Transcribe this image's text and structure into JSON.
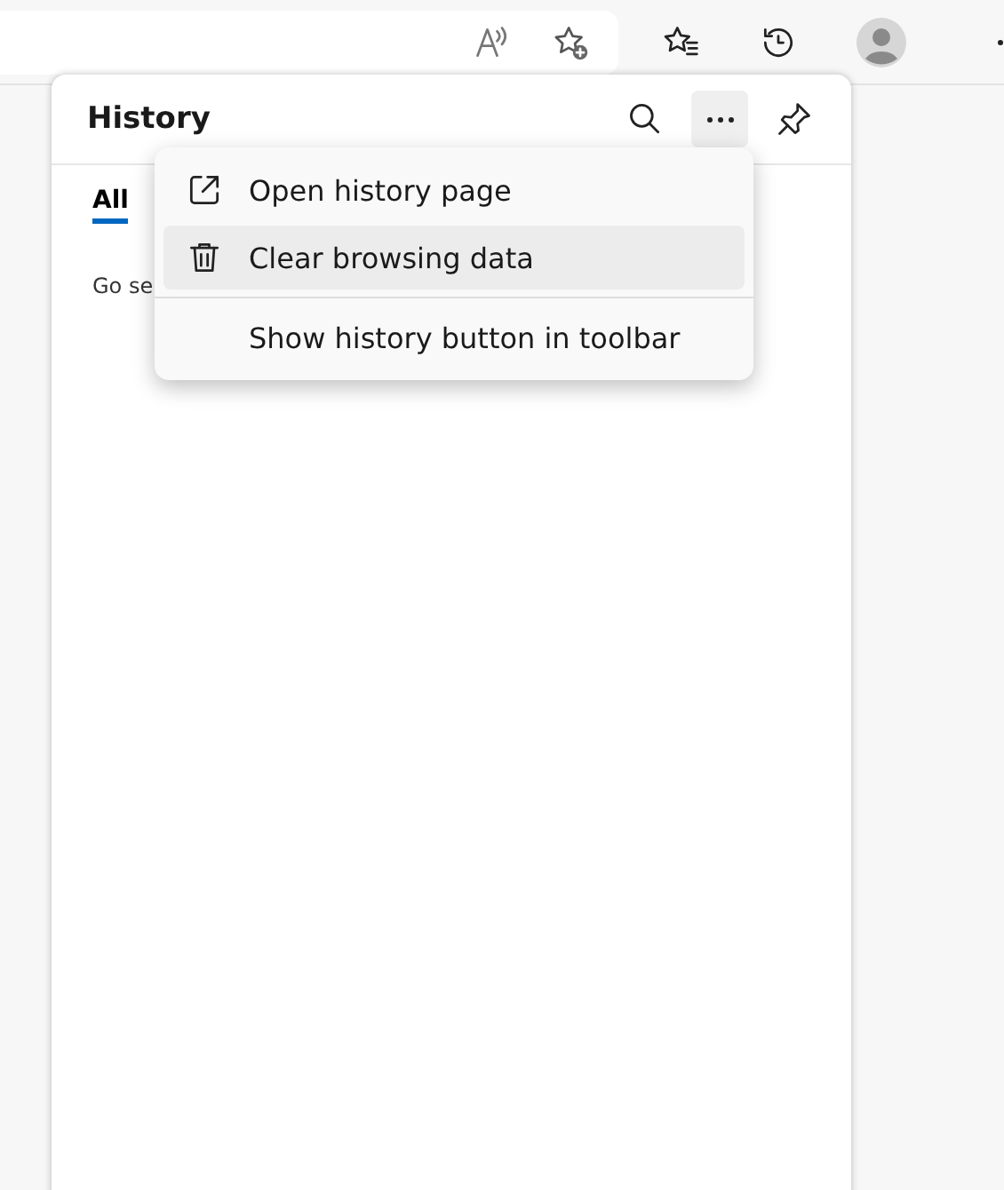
{
  "history_panel": {
    "title": "History",
    "more_selected": true,
    "tabs": [
      {
        "label": "All",
        "selected": true
      }
    ],
    "empty_text": "Go se"
  },
  "menu": {
    "items": [
      {
        "label": "Open history page",
        "kind": "external",
        "hovered": false,
        "divider_before": false
      },
      {
        "label": "Clear browsing data",
        "kind": "trash",
        "hovered": true,
        "divider_before": false
      },
      {
        "label": "Show history button in toolbar",
        "kind": "plain",
        "hovered": false,
        "divider_before": true
      }
    ]
  }
}
